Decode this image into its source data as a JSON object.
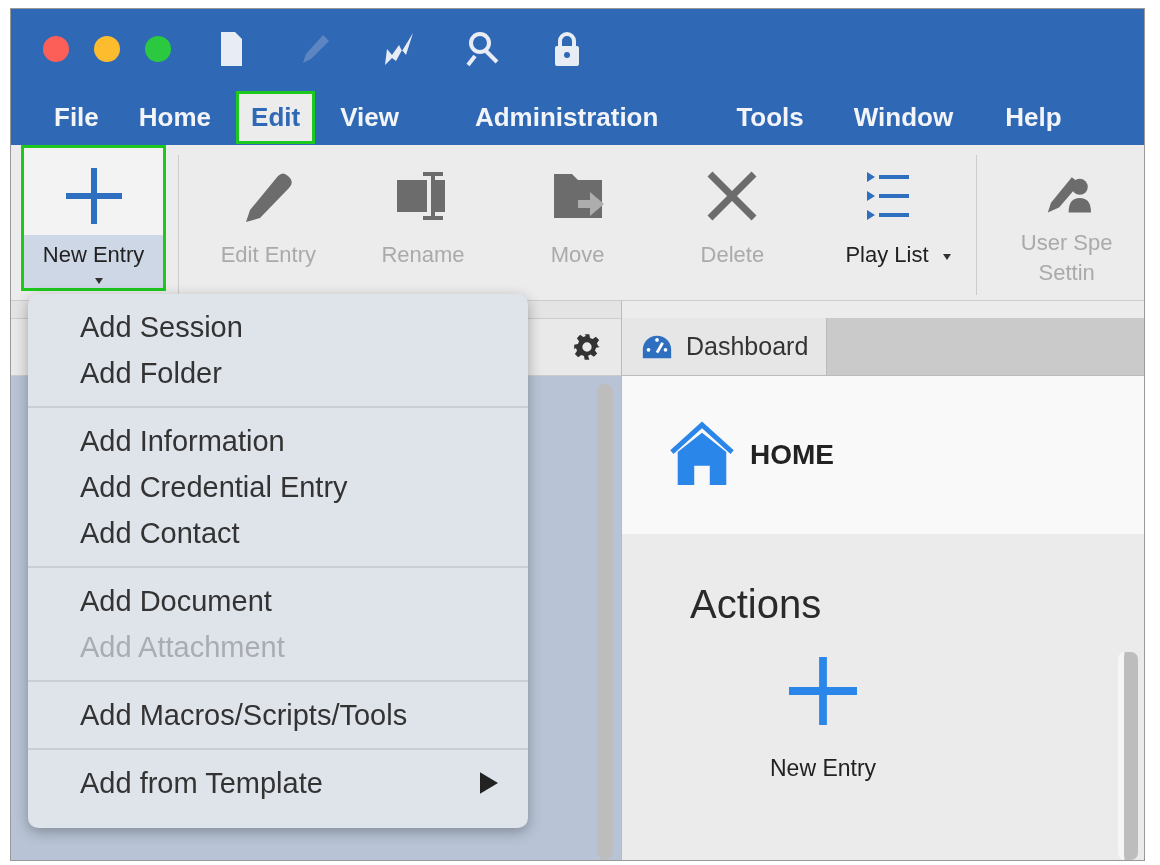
{
  "window": {
    "controls": [
      {
        "kind": "close"
      },
      {
        "kind": "minimize"
      },
      {
        "kind": "zoom"
      }
    ],
    "quick_icons": [
      {
        "kind": "document",
        "disabled": false
      },
      {
        "kind": "pencil",
        "disabled": true
      },
      {
        "kind": "bolt-arrow",
        "disabled": false
      },
      {
        "kind": "search-user",
        "disabled": false
      },
      {
        "kind": "lock",
        "disabled": false
      }
    ]
  },
  "menu_bar": [
    {
      "label": "File",
      "highlighted": false
    },
    {
      "label": "Home",
      "highlighted": false
    },
    {
      "label": "Edit",
      "highlighted": true
    },
    {
      "label": "View",
      "highlighted": false
    },
    {
      "label": "Administration",
      "highlighted": false
    },
    {
      "label": "Tools",
      "highlighted": false
    },
    {
      "label": "Window",
      "highlighted": false
    },
    {
      "label": "Help",
      "highlighted": false
    }
  ],
  "toolbar": [
    {
      "kind": "plus",
      "label_lines": [
        "New Entry"
      ],
      "disabled": false,
      "dropdown": true,
      "highlighted": true
    },
    {
      "kind": "pencil",
      "label_lines": [
        "Edit Entry"
      ],
      "disabled": true,
      "dropdown": false,
      "highlighted": false
    },
    {
      "kind": "rename",
      "label_lines": [
        "Rename"
      ],
      "disabled": true,
      "dropdown": false,
      "highlighted": false
    },
    {
      "kind": "move",
      "label_lines": [
        "Move"
      ],
      "disabled": true,
      "dropdown": false,
      "highlighted": false
    },
    {
      "kind": "delete",
      "label_lines": [
        "Delete"
      ],
      "disabled": true,
      "dropdown": false,
      "highlighted": false
    },
    {
      "kind": "playlist",
      "label_lines": [
        "Play List"
      ],
      "disabled": false,
      "dropdown": true,
      "highlighted": false
    },
    {
      "kind": "user-settings",
      "label_lines": [
        "User Spe",
        "Settin"
      ],
      "disabled": true,
      "dropdown": false,
      "highlighted": false
    }
  ],
  "dropdown_menu": {
    "groups": [
      {
        "items": [
          {
            "label": "Add Session",
            "disabled": false,
            "submenu": false
          },
          {
            "label": "Add Folder",
            "disabled": false,
            "submenu": false
          }
        ]
      },
      {
        "items": [
          {
            "label": "Add Information",
            "disabled": false,
            "submenu": false
          },
          {
            "label": "Add Credential Entry",
            "disabled": false,
            "submenu": false
          },
          {
            "label": "Add Contact",
            "disabled": false,
            "submenu": false
          }
        ]
      },
      {
        "items": [
          {
            "label": "Add Document",
            "disabled": false,
            "submenu": false
          },
          {
            "label": "Add Attachment",
            "disabled": true,
            "submenu": false
          }
        ]
      },
      {
        "items": [
          {
            "label": "Add Macros/Scripts/Tools",
            "disabled": false,
            "submenu": false
          }
        ]
      },
      {
        "items": [
          {
            "label": "Add from Template",
            "disabled": false,
            "submenu": true
          }
        ]
      }
    ]
  },
  "tabs": [
    {
      "label": "Dashboard",
      "selected": true
    }
  ],
  "dashboard": {
    "title": "HOME",
    "section": "Actions",
    "actions": [
      {
        "label": "New Entry"
      }
    ]
  }
}
